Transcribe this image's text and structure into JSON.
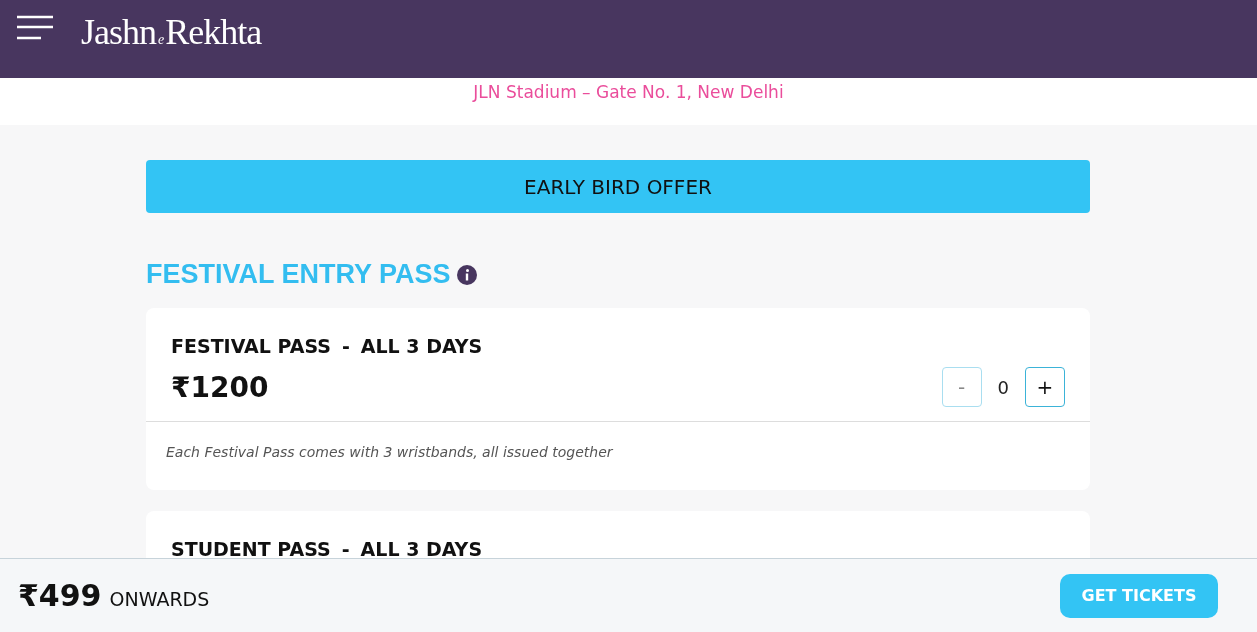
{
  "header": {
    "logo": {
      "main": "Jashn",
      "joiner": "e",
      "tail": "Rekhta"
    }
  },
  "location": "JLN Stadium – Gate No. 1, New Delhi",
  "offer_banner": "EARLY BIRD OFFER",
  "section": {
    "title": "FESTIVAL ENTRY PASS",
    "passes": [
      {
        "name": "FESTIVAL PASS",
        "separator": "-",
        "duration": "ALL 3 DAYS",
        "price": "₹1200",
        "minus": {
          "label": "-",
          "disabled": true
        },
        "quantity": "0",
        "plus": {
          "label": "+",
          "disabled": false
        },
        "note": "Each Festival Pass comes with 3 wristbands, all issued together"
      },
      {
        "name": "STUDENT PASS",
        "separator": "-",
        "duration": "ALL 3 DAYS"
      }
    ]
  },
  "bottom_bar": {
    "price": "₹499",
    "suffix": "ONWARDS",
    "button": "GET TICKETS"
  }
}
